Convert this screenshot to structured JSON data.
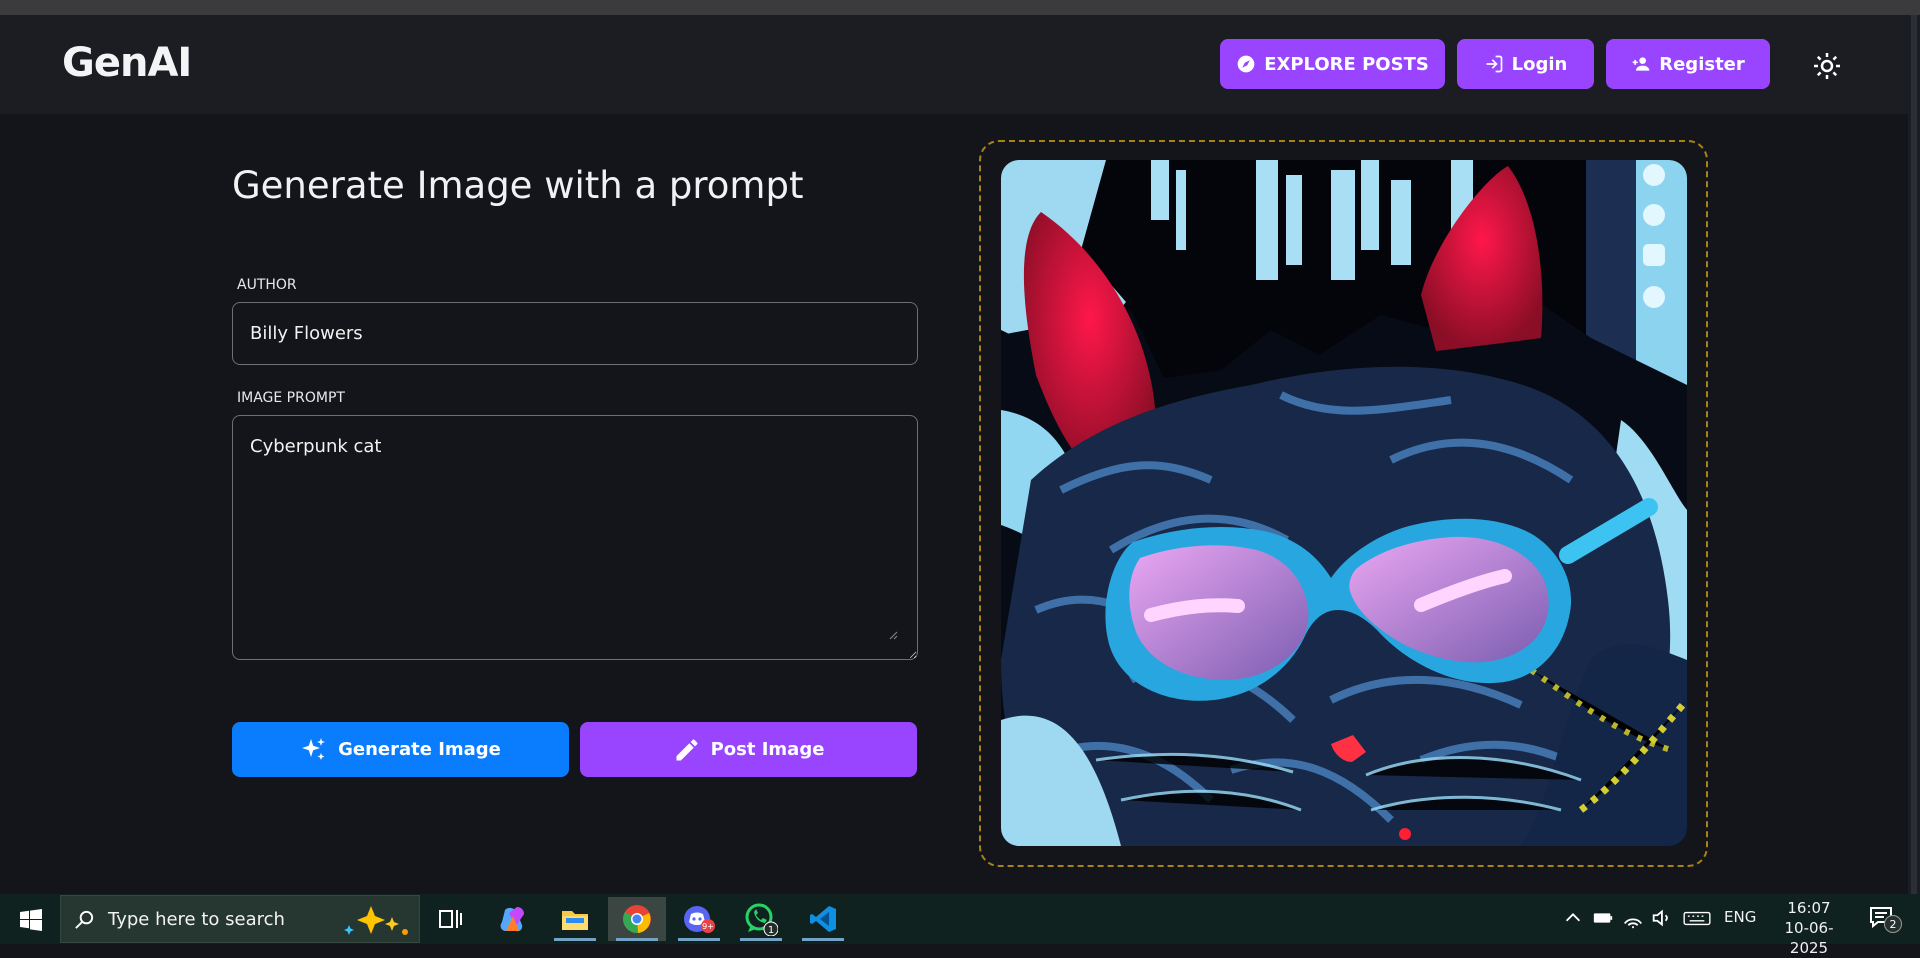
{
  "header": {
    "logo": "GenAI",
    "explore_label": "EXPLORE POSTS",
    "login_label": "Login",
    "register_label": "Register"
  },
  "form": {
    "title": "Generate Image with a prompt",
    "author_label": "AUTHOR",
    "author_value": "Billy Flowers",
    "prompt_label": "IMAGE PROMPT",
    "prompt_value": "Cyberpunk cat",
    "generate_label": "Generate Image",
    "post_label": "Post Image"
  },
  "image": {
    "alt": "Cyberpunk cat"
  },
  "taskbar": {
    "search_placeholder": "Type here to search",
    "discord_badge": "9+",
    "whatsapp_badge": "1",
    "language": "ENG",
    "time": "16:07",
    "date": "10-06-2025",
    "notification_count": "2"
  },
  "colors": {
    "background": "#13151b",
    "header": "#1b1d23",
    "accent_purple": "#9945ff",
    "accent_blue": "#0a7dff",
    "frame_gold": "#a98312"
  },
  "icons": {
    "explore": "compass-icon",
    "login": "login-icon",
    "register": "add-user-icon",
    "theme": "sun-icon",
    "generate": "sparkle-icon",
    "post": "pencil-icon"
  }
}
